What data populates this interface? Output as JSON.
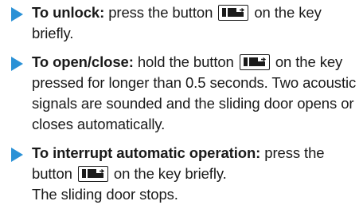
{
  "steps": [
    {
      "lead": "To unlock:",
      "text_before": " press the button ",
      "icon": "sliding-door-key-icon",
      "text_after": " on the key briefly."
    },
    {
      "lead": "To open/close:",
      "text_before": " hold the button ",
      "icon": "sliding-door-key-icon",
      "text_after": " on the key pressed for longer than 0.5 seconds. Two acoustic signals are sounded and the sliding door opens or closes automatically."
    },
    {
      "lead": "To interrupt automatic operation:",
      "text_before": " press the button ",
      "icon": "sliding-door-key-icon",
      "text_after": " on the key briefly.",
      "result": "The sliding door stops."
    }
  ],
  "colors": {
    "bullet": "#2a91d6",
    "text": "#1a1a1a"
  }
}
